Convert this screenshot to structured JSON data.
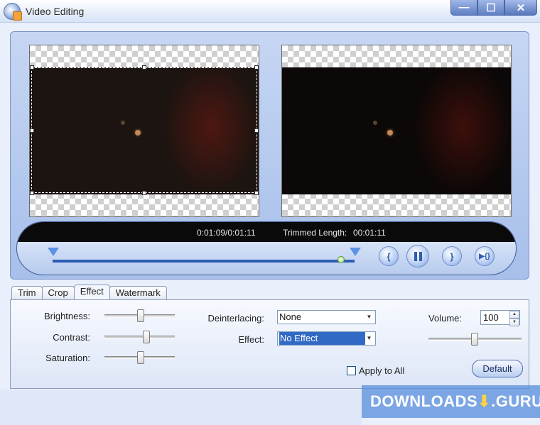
{
  "window": {
    "title": "Video Editing",
    "controls": {
      "minimize": "—",
      "maximize": "☐",
      "close": "✕"
    }
  },
  "player": {
    "time": "0:01:09/0:01:11",
    "trimmed_label": "Trimmed Length:",
    "trimmed_value": "00:01:11",
    "progress_fraction": 0.96,
    "controls": {
      "mark_in": "{",
      "mark_out": "}",
      "preview_trimmed": "▶{}"
    }
  },
  "tabs": [
    "Trim",
    "Crop",
    "Effect",
    "Watermark"
  ],
  "active_tab": "Effect",
  "effect": {
    "brightness_label": "Brightness:",
    "contrast_label": "Contrast:",
    "saturation_label": "Saturation:",
    "deinterlacing_label": "Deinterlacing:",
    "deinterlacing_value": "None",
    "effect_label": "Effect:",
    "effect_value": "No Effect",
    "volume_label": "Volume:",
    "volume_value": "100",
    "apply_all_label": "Apply to All",
    "apply_all_checked": false,
    "default_button": "Default"
  },
  "watermark_overlay": {
    "text_left": "DOWNLOADS",
    "arrow": "⬇",
    "text_right": ".GURU"
  }
}
